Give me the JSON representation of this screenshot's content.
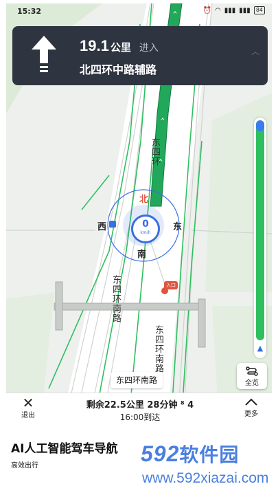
{
  "status": {
    "time": "15:32",
    "battery": "84"
  },
  "guidance": {
    "distance_value": "19.1",
    "distance_unit": "公里",
    "action": "进入",
    "road": "北四环中路辅路"
  },
  "map": {
    "compass": {
      "north": "北",
      "south": "南",
      "east": "东",
      "west": "西"
    },
    "speed": {
      "value": "0",
      "unit": "km/h"
    },
    "labels": {
      "east_ring_upper": "东四环",
      "east_ring_south_a": "东四环南路",
      "east_ring_south_b": "东四环南路",
      "entrance": "入口"
    }
  },
  "current_road": "东四环南路",
  "overview_label": "全览",
  "bottom": {
    "exit_label": "退出",
    "more_label": "更多",
    "remaining": "剩余22.5公里 28分钟 ⁸ 4",
    "arrival": "16:00到达"
  },
  "caption": {
    "title": "AI人工智能驾车导航",
    "subtitle": "高效出行"
  },
  "watermark": {
    "logo_num": "592",
    "logo_text": "软件园",
    "url": "www.592xiazai.com"
  },
  "colors": {
    "route": "#2fbf5f",
    "card": "#2e3440",
    "accent": "#3a6fe0"
  }
}
